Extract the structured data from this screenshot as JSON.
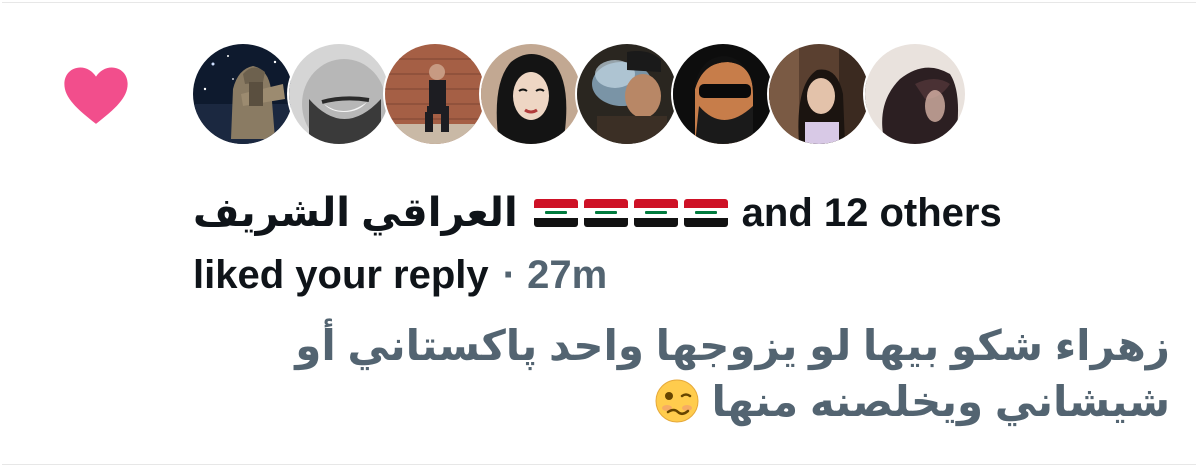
{
  "notification": {
    "names": "العراقي الشريف",
    "flags": [
      "iraq-flag",
      "iraq-flag",
      "iraq-flag",
      "iraq-flag"
    ],
    "and_others": "and 12 others",
    "liked_text": "liked your reply",
    "separator": "·",
    "timestamp": "27m",
    "reply_text": "زهراء شكو بيها لو يزوجها واحد پاكستاني أو شيشاني ويخلصنه منها",
    "emoji": "woozy-face-emoji",
    "heart_color": "#f24e8c"
  },
  "avatars": [
    {
      "name": "avatar-lamassu-space"
    },
    {
      "name": "avatar-beard-smile"
    },
    {
      "name": "avatar-man-suit-brick"
    },
    {
      "name": "avatar-woman-illustration"
    },
    {
      "name": "avatar-smoke-cap"
    },
    {
      "name": "avatar-cartoon-sunglasses"
    },
    {
      "name": "avatar-woman-restaurant"
    },
    {
      "name": "avatar-dark-hair"
    }
  ]
}
